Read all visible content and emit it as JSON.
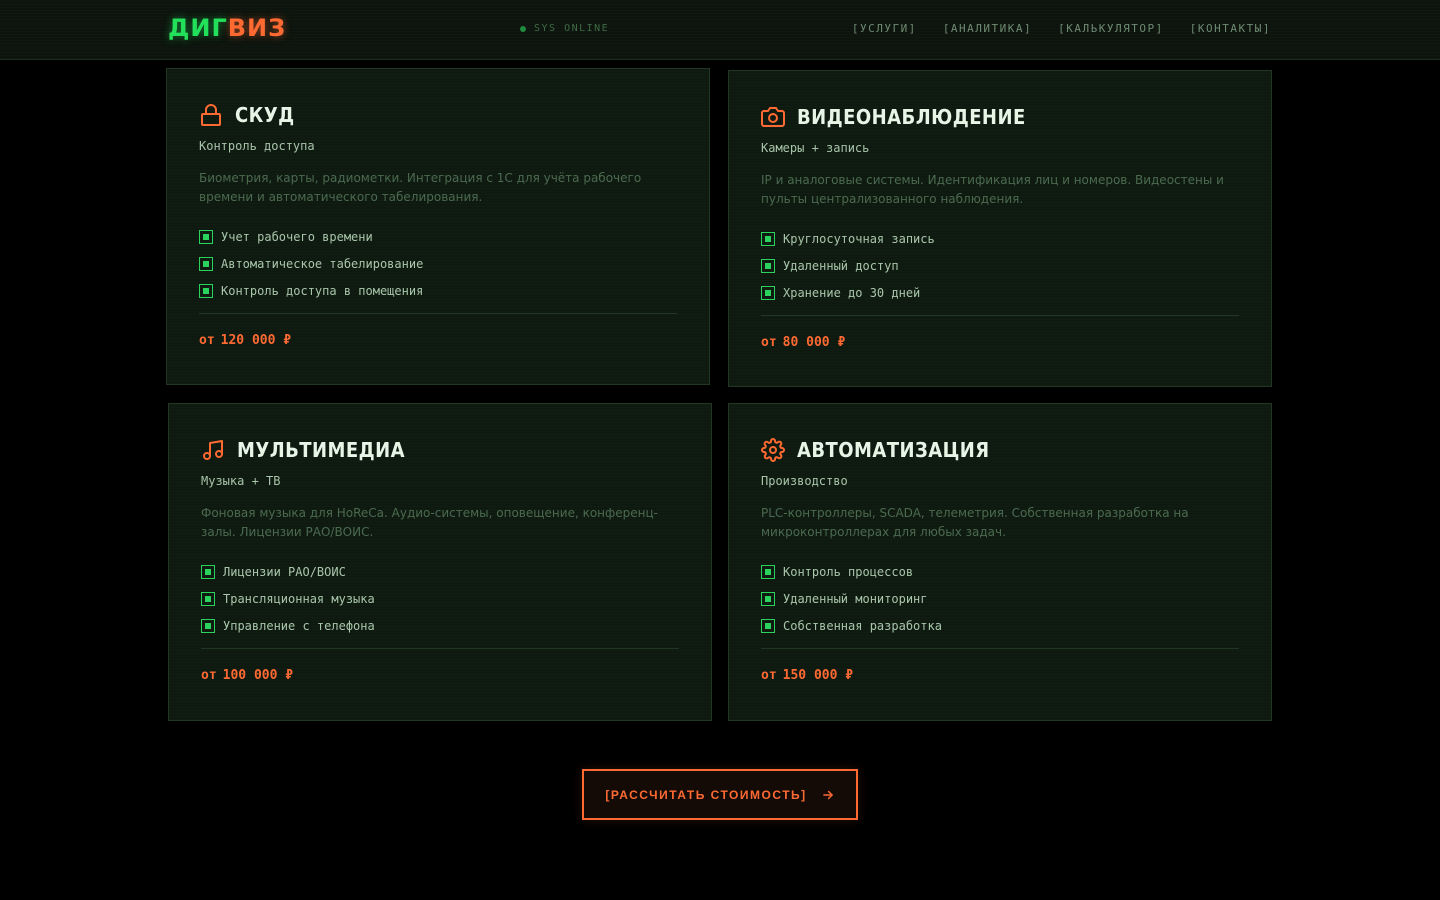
{
  "header": {
    "logo_part1": "ДИГ",
    "logo_part2": "ВИЗ",
    "status": "SYS ONLINE",
    "nav": [
      "[УСЛУГИ]",
      "[АНАЛИТИКА]",
      "[КАЛЬКУЛЯТОР]",
      "[КОНТАКТЫ]"
    ]
  },
  "cards": [
    {
      "icon": "lock-icon",
      "title": "СКУД",
      "subtitle": "Контроль доступа",
      "description": "Биометрия, карты, радиометки. Интеграция с 1С для учёта рабочего времени и автоматического табелирования.",
      "features": [
        "Учет рабочего времени",
        "Автоматическое табелирование",
        "Контроль доступа в помещения"
      ],
      "price_prefix": "от",
      "price": "120 000 ₽"
    },
    {
      "icon": "camera-icon",
      "title": "ВИДЕОНАБЛЮДЕНИЕ",
      "subtitle": "Камеры + запись",
      "description": "IP и аналоговые системы. Идентификация лиц и номеров. Видеостены и пульты централизованного наблюдения.",
      "features": [
        "Круглосуточная запись",
        "Удаленный доступ",
        "Хранение до 30 дней"
      ],
      "price_prefix": "от",
      "price": "80 000 ₽"
    },
    {
      "icon": "music-icon",
      "title": "МУЛЬТИМЕДИА",
      "subtitle": "Музыка + ТВ",
      "description": "Фоновая музыка для HoReCa. Аудио-системы, оповещение, конференц-залы. Лицензии РАО/ВОИС.",
      "features": [
        "Лицензии РАО/ВОИС",
        "Трансляционная музыка",
        "Управление с телефона"
      ],
      "price_prefix": "от",
      "price": "100 000 ₽"
    },
    {
      "icon": "gear-icon",
      "title": "АВТОМАТИЗАЦИЯ",
      "subtitle": "Производство",
      "description": "PLC-контроллеры, SCADA, телеметрия. Собственная разработка на микроконтроллерах для любых задач.",
      "features": [
        "Контроль процессов",
        "Удаленный мониторинг",
        "Собственная разработка"
      ],
      "price_prefix": "от",
      "price": "150 000 ₽"
    }
  ],
  "cta": {
    "label": "[РАССЧИТАТЬ СТОИМОСТЬ]"
  },
  "colors": {
    "accent": "#ff6a33",
    "green": "#22e05a",
    "card_bg": "#0e1a10"
  }
}
